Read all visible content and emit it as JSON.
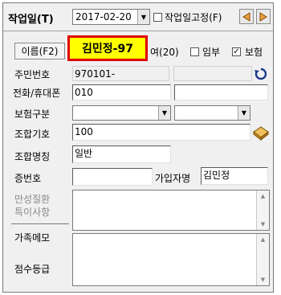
{
  "toolbar": {
    "work_date_label": "작업일(T)",
    "work_date_value": "2017-02-20",
    "fix_date_label": "작업일고정(F)",
    "fix_date_checked": false
  },
  "patient": {
    "name_button_label": "이름(F2)",
    "name_value": "김민정-97",
    "female_label": "여(20)",
    "pregnant_label": "임부",
    "pregnant_checked": false,
    "insurance_label": "보험",
    "insurance_checked": true
  },
  "form": {
    "resident_no_label": "주민번호",
    "resident_no_value": "970101-",
    "phone_label": "전화/휴대폰",
    "phone_value": "010",
    "phone2_value": "",
    "insurance_type_label": "보험구분",
    "insurance_type_value": "",
    "insurance_type2_value": "",
    "union_code_label": "조합기호",
    "union_code_value": "100",
    "union_name_label": "조합명칭",
    "union_name_value": "일반",
    "cert_no_label": "증번호",
    "cert_no_value": "",
    "subscriber_label": "가입자명",
    "subscriber_value": "김민정"
  },
  "notes": {
    "chronic_label_1": "만성질환",
    "chronic_label_2": "특이사항",
    "family_memo_label": "가족메모",
    "score_grade_label": "점수등급"
  },
  "colors": {
    "highlight_border": "#e00000",
    "highlight_fill": "#ffff00",
    "disabled_text": "#8a8a8a"
  }
}
